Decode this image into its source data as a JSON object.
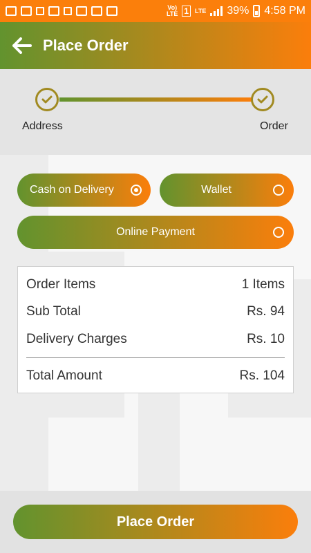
{
  "status_bar": {
    "battery": "39%",
    "time": "4:58 PM",
    "network_top": "Vo)",
    "network_bottom": "LTE",
    "sim": "1",
    "lte_label": "LTE"
  },
  "header": {
    "title": "Place Order",
    "back_icon": "arrow-left-icon"
  },
  "stepper": {
    "steps": [
      {
        "label": "Address",
        "status": "complete"
      },
      {
        "label": "Order",
        "status": "complete"
      }
    ]
  },
  "payment_options": [
    {
      "label": "Cash on Delivery",
      "selected": true
    },
    {
      "label": "Wallet",
      "selected": false
    },
    {
      "label": "Online Payment",
      "selected": false
    }
  ],
  "summary": {
    "rows": [
      {
        "label": "Order Items",
        "value": "1 Items"
      },
      {
        "label": "Sub Total",
        "value": "Rs. 94"
      },
      {
        "label": "Delivery Charges",
        "value": "Rs. 10"
      }
    ],
    "total": {
      "label": "Total Amount",
      "value": "Rs. 104"
    }
  },
  "actions": {
    "place_order_label": "Place Order"
  },
  "colors": {
    "accent_green": "#62932e",
    "accent_orange": "#fb7e0b",
    "status_bar": "#fb7f0b"
  }
}
